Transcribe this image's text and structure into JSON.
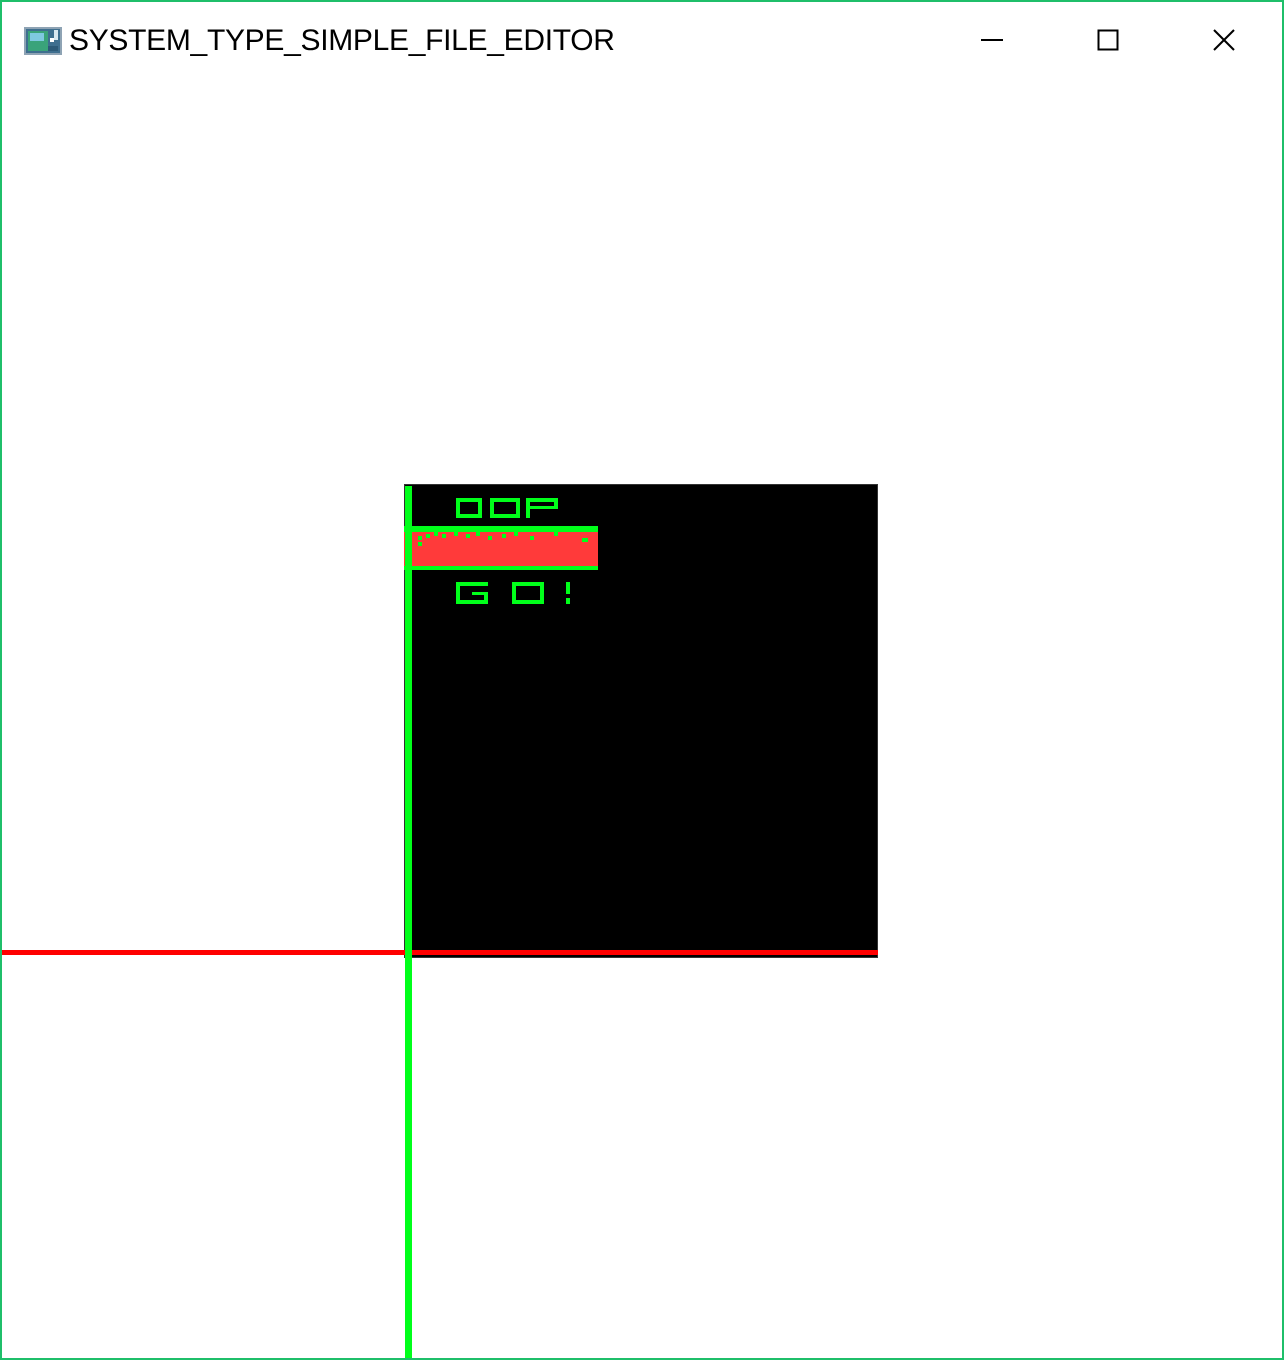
{
  "window": {
    "title": "SYSTEM_TYPE_SIMPLE_FILE_EDITOR",
    "border_color": "#1fbf6a"
  },
  "title_bar": {
    "icon": "app-icon",
    "buttons": [
      {
        "name": "minimize",
        "icon": "minimize-icon"
      },
      {
        "name": "maximize",
        "icon": "maximize-icon"
      },
      {
        "name": "close",
        "icon": "close-icon"
      }
    ]
  },
  "scene": {
    "background_color": "#000000",
    "x_axis_color": "#ff0000",
    "y_axis_color": "#00ff1a",
    "sprite_text_top": "OOP",
    "sprite_text_bottom": "GO!",
    "sprite_text_color": "#00ff1a",
    "sprite_bar_color": "#ff3a3a"
  }
}
